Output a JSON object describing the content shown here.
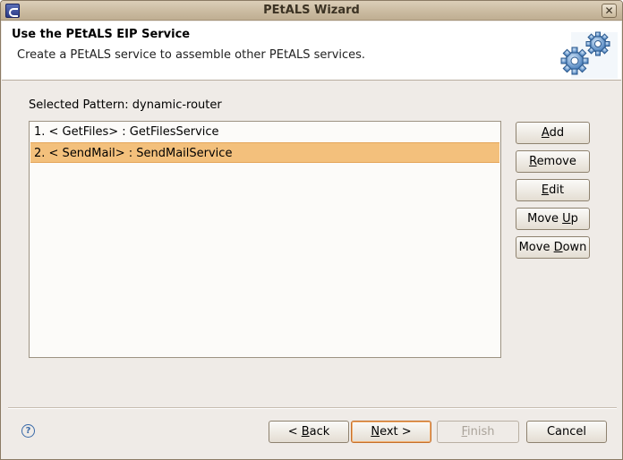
{
  "window": {
    "title": "PEtALS Wizard",
    "close_glyph": "✕"
  },
  "header": {
    "title": "Use the PEtALS EIP Service",
    "description": "Create a PEtALS service to assemble other PEtALS services.",
    "icon": "gears-icon"
  },
  "pattern": {
    "label": "Selected Pattern: dynamic-router"
  },
  "services": {
    "items": [
      {
        "label": "1. < GetFiles> : GetFilesService",
        "selected": false
      },
      {
        "label": "2. < SendMail> : SendMailService",
        "selected": true
      }
    ]
  },
  "side_buttons": {
    "add": {
      "pre": "",
      "mn": "A",
      "post": "dd"
    },
    "remove": {
      "pre": "",
      "mn": "R",
      "post": "emove"
    },
    "edit": {
      "pre": "",
      "mn": "E",
      "post": "dit"
    },
    "move_up": {
      "pre": "Move ",
      "mn": "U",
      "post": "p"
    },
    "move_down": {
      "pre": "Move ",
      "mn": "D",
      "post": "own"
    }
  },
  "footer": {
    "help_glyph": "?",
    "back": {
      "pre": "< ",
      "mn": "B",
      "post": "ack"
    },
    "next": {
      "pre": "",
      "mn": "N",
      "post": "ext >"
    },
    "finish": {
      "pre": "",
      "mn": "F",
      "post": "inish",
      "disabled": true
    },
    "cancel": "Cancel"
  },
  "colors": {
    "selection": "#f3c07c",
    "dialog_bg": "#efebe7",
    "titlebar": "#cbbba1"
  }
}
